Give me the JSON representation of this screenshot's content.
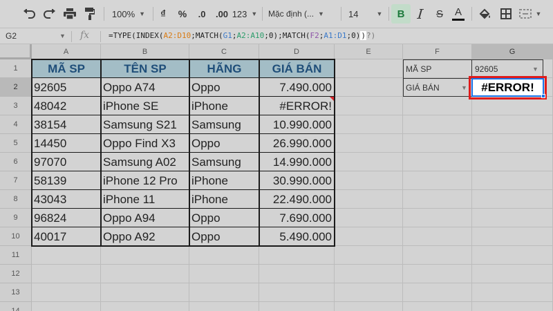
{
  "toolbar": {
    "zoom": "100%",
    "currency": "₫",
    "percent": "%",
    "decrease_decimals": ".0",
    "increase_decimals": ".00",
    "more_formats": "123",
    "font_family": "Mặc định (...",
    "font_size": "14",
    "bold": "B",
    "strike": "S",
    "text_color": "A"
  },
  "formula_bar": {
    "name_box": "G2",
    "fx": "fx",
    "formula_parts": [
      {
        "t": "=TYPE(INDEX(",
        "c": ""
      },
      {
        "t": "A2:D10",
        "c": "r-or"
      },
      {
        "t": ";MATCH(",
        "c": ""
      },
      {
        "t": "G1",
        "c": "r-bl"
      },
      {
        "t": ";",
        "c": ""
      },
      {
        "t": "A2:A10",
        "c": "r-gr"
      },
      {
        "t": ";0);MATCH(",
        "c": ""
      },
      {
        "t": "F2",
        "c": "r-pu"
      },
      {
        "t": ";",
        "c": ""
      },
      {
        "t": "A1:D1",
        "c": "r-bl"
      },
      {
        "t": ";0)",
        "c": ""
      },
      {
        "t": ")",
        "c": "caretbox"
      },
      {
        "t": "?)",
        "c": "r-gy"
      }
    ]
  },
  "columns": [
    "A",
    "B",
    "C",
    "D",
    "E",
    "F",
    "G"
  ],
  "selected_column": "G",
  "rows": [
    "1",
    "2",
    "3",
    "4",
    "5",
    "6",
    "7",
    "8",
    "9",
    "10",
    "11",
    "12",
    "13",
    "14"
  ],
  "selected_row": "2",
  "table": {
    "headers": [
      "MÃ SP",
      "TÊN SP",
      "HÃNG",
      "GIÁ BÁN"
    ],
    "header_color": "#a3bdc6",
    "header_text_color": "#1f4e79",
    "rows": [
      [
        "92605",
        "Oppo A74",
        "Oppo",
        "7.490.000"
      ],
      [
        "48042",
        "iPhone SE",
        "iPhone",
        "#ERROR!"
      ],
      [
        "38154",
        "Samsung S21",
        "Samsung",
        "10.990.000"
      ],
      [
        "14450",
        "Oppo Find X3",
        "Oppo",
        "26.990.000"
      ],
      [
        "97070",
        "Samsung A02",
        "Samsung",
        "14.990.000"
      ],
      [
        "58139",
        "iPhone 12 Pro",
        "iPhone",
        "30.990.000"
      ],
      [
        "43043",
        "iPhone 11",
        "iPhone",
        "22.490.000"
      ],
      [
        "96824",
        "Oppo A94",
        "Oppo",
        "7.690.000"
      ],
      [
        "40017",
        "Oppo A92",
        "Oppo",
        "5.490.000"
      ]
    ]
  },
  "lookup": {
    "f1_label": "MÃ SP",
    "g1_value": "92605",
    "f2_label": "GIÁ BÁN",
    "g2_value": "#ERROR!"
  },
  "colors": {
    "highlight_border": "#e01b1b",
    "selection_blue": "#1a73e8",
    "error_flag": "#d9262b"
  }
}
